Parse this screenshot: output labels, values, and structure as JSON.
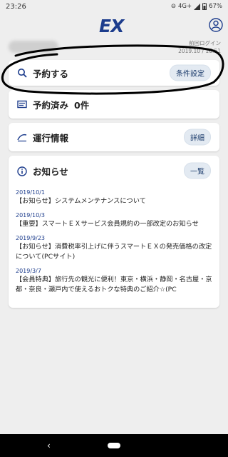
{
  "status_bar": {
    "time": "23:26",
    "network": "4G+",
    "battery": "67%"
  },
  "header": {
    "logo": "EX",
    "user_icon": "person-icon"
  },
  "user": {
    "last_login_label": "前回ログイン",
    "last_login_time": "2019.10 / 16:51"
  },
  "reserve": {
    "label": "予約する",
    "button": "条件設定",
    "icon": "search-icon"
  },
  "booked": {
    "label": "予約済み",
    "count": "0件",
    "icon": "ticket-icon"
  },
  "operation": {
    "label": "運行情報",
    "button": "詳細",
    "icon": "train-icon"
  },
  "news": {
    "title": "お知らせ",
    "button": "一覧",
    "icon": "info-icon",
    "items": [
      {
        "date": "2019/10/1",
        "text": "【お知らせ】システムメンテナンスについて"
      },
      {
        "date": "2019/10/3",
        "text": "【重要】スマートＥＸサービス会員規約の一部改定のお知らせ"
      },
      {
        "date": "2019/9/23",
        "text": "【お知らせ】消費税率引上げに伴うスマートＥＸの発売価格の改定について(PCサイト)"
      },
      {
        "date": "2019/3/7",
        "text": "【会員特典】旅行先の観光に便利！東京・横浜・静岡・名古屋・京都・奈良・瀬戸内で使えるおトクな特典のご紹介☆(PC"
      }
    ]
  },
  "nav": {
    "back": "back-icon",
    "home": "home-icon"
  }
}
